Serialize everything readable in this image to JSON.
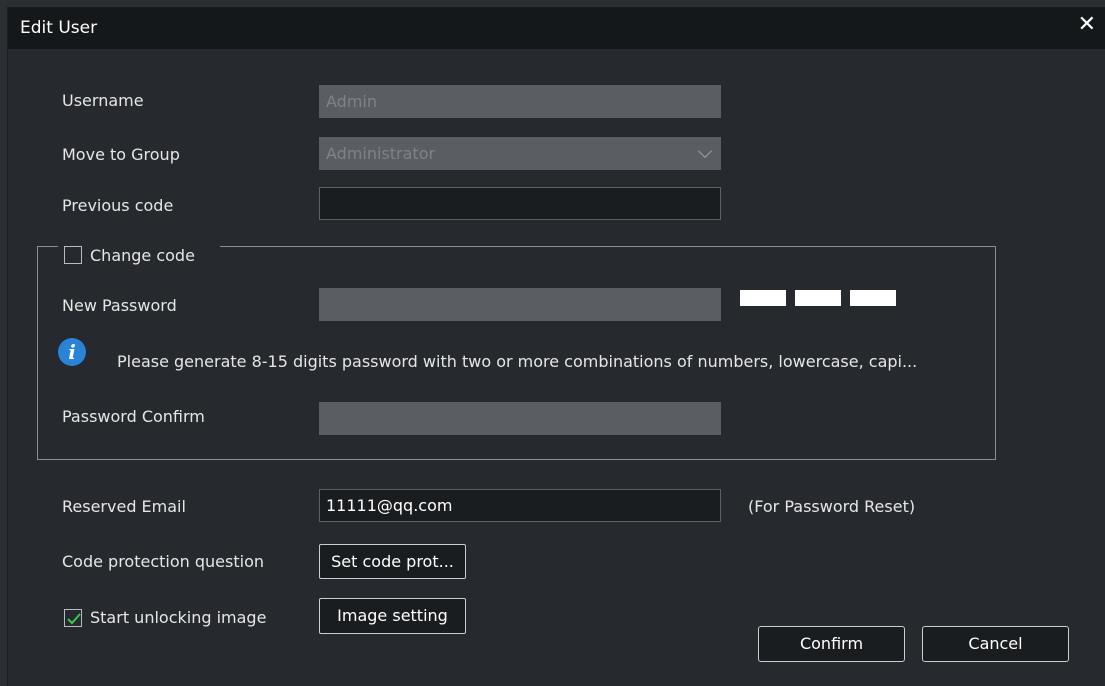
{
  "dialog": {
    "title": "Edit User",
    "close_symbol": "✕"
  },
  "form": {
    "username_label": "Username",
    "username_value": "Admin",
    "group_label": "Move to Group",
    "group_value": "Administrator",
    "previous_code_label": "Previous code",
    "previous_code_value": "",
    "change_code_label": "Change code",
    "change_code_checked": false,
    "new_password_label": "New Password",
    "info_symbol": "i",
    "password_hint": "Please generate 8-15 digits password with two or more combinations of numbers, lowercase, capi...",
    "password_confirm_label": "Password Confirm",
    "reserved_email_label": "Reserved Email",
    "reserved_email_value": "11111@qq.com",
    "reserved_email_note": "(For Password Reset)",
    "code_protection_label": "Code protection question",
    "code_protection_button": "Set code prot...",
    "unlock_image_label": "Start unlocking image",
    "unlock_image_checked": true,
    "image_setting_button": "Image setting"
  },
  "footer": {
    "confirm_label": "Confirm",
    "cancel_label": "Cancel"
  },
  "colors": {
    "title_bar": "#15181b",
    "background": "#262a2e",
    "checkmark": "#3cc84a",
    "info_icon": "#2a83d6",
    "strength_bar": "#ffffff"
  }
}
